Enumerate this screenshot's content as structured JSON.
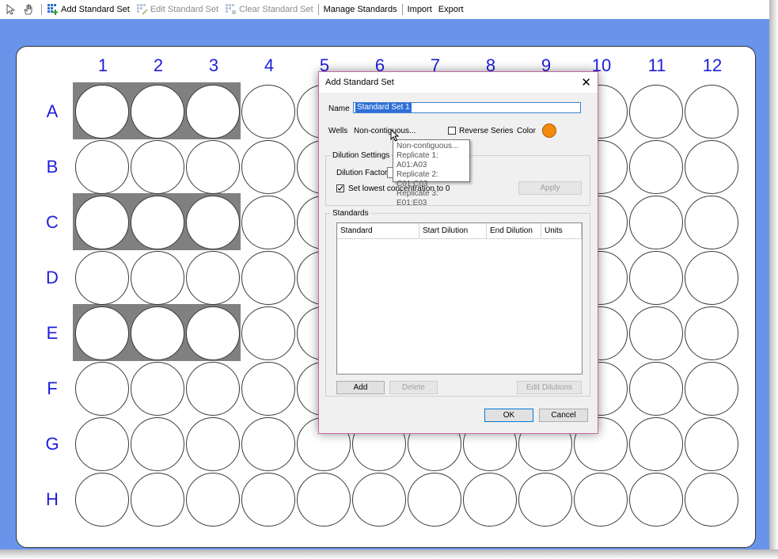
{
  "toolbar": {
    "items": [
      {
        "label": "Add Standard Set",
        "icon": "grid-plus-icon",
        "enabled": true
      },
      {
        "label": "Edit Standard Set",
        "icon": "grid-edit-icon",
        "enabled": false
      },
      {
        "label": "Clear Standard Set",
        "icon": "grid-clear-icon",
        "enabled": false
      },
      {
        "label": "Manage Standards",
        "enabled": true
      },
      {
        "label": "Import",
        "enabled": true
      },
      {
        "label": "Export",
        "enabled": true
      }
    ]
  },
  "plate": {
    "columns": [
      "1",
      "2",
      "3",
      "4",
      "5",
      "6",
      "7",
      "8",
      "9",
      "10",
      "11",
      "12"
    ],
    "rows": [
      "A",
      "B",
      "C",
      "D",
      "E",
      "F",
      "G",
      "H"
    ],
    "selected_rows": [
      "A",
      "C",
      "E"
    ],
    "selected_columns": [
      "1",
      "2",
      "3"
    ],
    "label_color": "#1e1edc",
    "frame_color": "#6a94ea"
  },
  "dialog": {
    "title": "Add Standard Set",
    "name_label": "Name",
    "name_value": "Standard Set 1",
    "wells_label": "Wells",
    "wells_value": "Non-contiguous...",
    "reverse_series_label": "Reverse Series",
    "color_label": "Color",
    "color_value": "#f28a0f",
    "dilution_group": "Dilution Settings",
    "dilution_factor_label": "Dilution Factor",
    "set_lowest_label": "Set lowest concentration to 0",
    "apply_label": "Apply",
    "standards_group": "Standards",
    "columns": [
      "Standard",
      "Start Dilution",
      "End Dilution",
      "Units"
    ],
    "add_label": "Add",
    "delete_label": "Delete",
    "edit_dilutions_label": "Edit Dilutions",
    "ok_label": "OK",
    "cancel_label": "Cancel"
  },
  "tooltip": {
    "lines": [
      "Non-contiguous...",
      "Replicate 1: A01:A03",
      "Replicate 2: C01:C03",
      "Replicate 3: E01:E03"
    ]
  }
}
